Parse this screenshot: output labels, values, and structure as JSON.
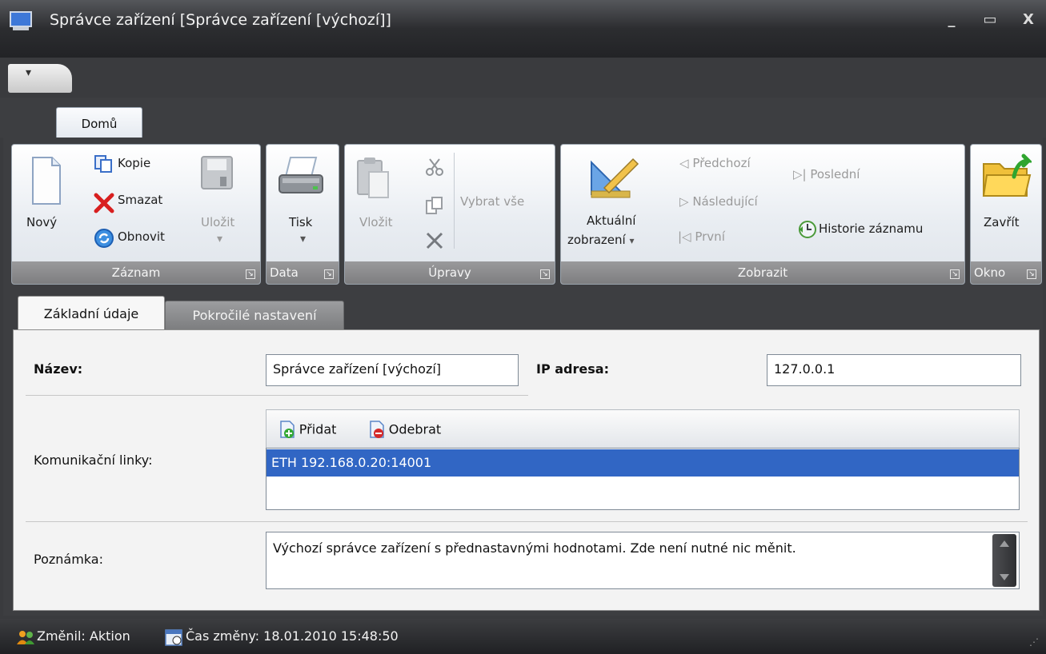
{
  "window": {
    "title": "Správce zařízení [Správce zařízení [výchozí]]",
    "controls": {
      "minimize": "_",
      "maximize": "▭",
      "close": "X"
    }
  },
  "qat": {
    "dropdown": "▾"
  },
  "ribbon": {
    "tabs": [
      {
        "label": "Domů",
        "active": true
      }
    ],
    "groups": {
      "zaznam": {
        "label": "Záznam",
        "new": "Nový",
        "copy": "Kopie",
        "delete": "Smazat",
        "refresh": "Obnovit",
        "save": "Uložit"
      },
      "data": {
        "label": "Data",
        "print": "Tisk"
      },
      "upravy": {
        "label": "Úpravy",
        "paste": "Vložit",
        "select_all": "Vybrat vše"
      },
      "zobrazit": {
        "label": "Zobrazit",
        "current_view_line1": "Aktuální",
        "current_view_line2": "zobrazení",
        "previous": "Předchozí",
        "next": "Následující",
        "first": "První",
        "last": "Poslední",
        "history": "Historie záznamu"
      },
      "okno": {
        "label": "Okno",
        "close": "Zavřít"
      }
    }
  },
  "form": {
    "tabs": [
      {
        "label": "Základní údaje",
        "active": true
      },
      {
        "label": "Pokročilé nastavení",
        "active": false
      }
    ],
    "name_label": "Název:",
    "name_value": "Správce zařízení [výchozí]",
    "ip_label": "IP adresa:",
    "ip_value": "127.0.0.1",
    "links_label": "Komunikační linky:",
    "links_add": "Přidat",
    "links_remove": "Odebrat",
    "links": [
      "ETH 192.168.0.20:14001"
    ],
    "note_label": "Poznámka:",
    "note_value": "Výchozí správce zařízení s přednastavnými hodnotami. Zde není nutné nic měnit."
  },
  "status": {
    "changed_by": "Změnil: Aktion",
    "changed_time": "Čas změny: 18.01.2010 15:48:50"
  },
  "colors": {
    "accent_selection": "#3166c4",
    "chrome_dark": "#3d3e41"
  }
}
